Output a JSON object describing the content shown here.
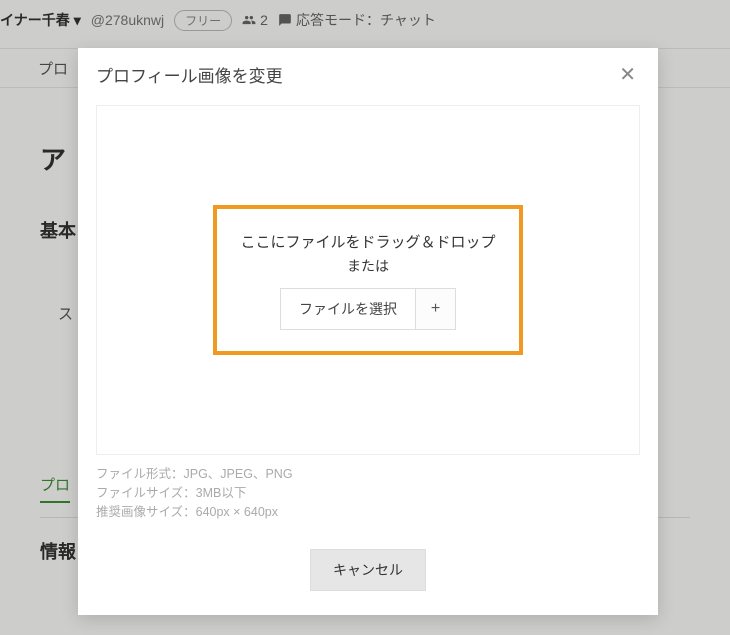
{
  "topbar": {
    "username": "イナー千春",
    "handle": "@278uknwj",
    "badge": "フリー",
    "people_count": "2",
    "mode_label": "応答モード：チャット"
  },
  "tabs": {
    "profile_partial": "プロ"
  },
  "page": {
    "heading_partial": "ア",
    "section1_partial": "基本",
    "row_label_partial": "ス",
    "subnav_partial": "プロ",
    "section2_partial": "情報"
  },
  "modal": {
    "title": "プロフィール画像を変更",
    "drop_line1": "ここにファイルをドラッグ＆ドロップ",
    "drop_line2": "または",
    "file_button": "ファイルを選択",
    "plus": "+",
    "hint_format": "ファイル形式：JPG、JPEG、PNG",
    "hint_size": "ファイルサイズ：3MB以下",
    "hint_dim": "推奨画像サイズ：640px × 640px",
    "cancel": "キャンセル"
  }
}
